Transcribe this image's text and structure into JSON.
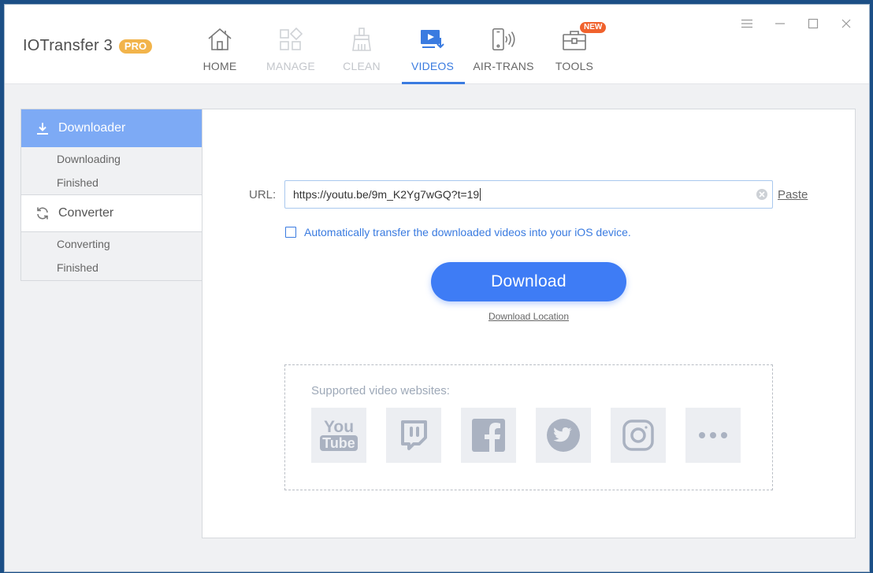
{
  "app": {
    "name": "IOTransfer 3",
    "badge": "PRO"
  },
  "nav": {
    "items": [
      {
        "label": "HOME",
        "icon": "home-icon",
        "state": "normal"
      },
      {
        "label": "MANAGE",
        "icon": "grid-icon",
        "state": "disabled"
      },
      {
        "label": "CLEAN",
        "icon": "broom-icon",
        "state": "disabled"
      },
      {
        "label": "VIDEOS",
        "icon": "video-download-icon",
        "state": "active"
      },
      {
        "label": "AIR-TRANS",
        "icon": "phone-wireless-icon",
        "state": "normal"
      },
      {
        "label": "TOOLS",
        "icon": "toolbox-icon",
        "state": "normal",
        "badge": "NEW"
      }
    ]
  },
  "window_controls": [
    "menu-icon",
    "minimize-icon",
    "maximize-icon",
    "close-icon"
  ],
  "sidebar": {
    "downloader": {
      "label": "Downloader",
      "icon": "download-icon",
      "items": [
        "Downloading",
        "Finished"
      ]
    },
    "converter": {
      "label": "Converter",
      "icon": "refresh-icon",
      "items": [
        "Converting",
        "Finished"
      ]
    }
  },
  "main": {
    "url_label": "URL:",
    "url_value": "https://youtu.be/9m_K2Yg7wGQ?t=19",
    "paste_label": "Paste",
    "auto_transfer_label": "Automatically transfer the downloaded videos into your iOS device.",
    "auto_transfer_checked": false,
    "download_label": "Download",
    "download_location_label": "Download Location",
    "supported_title": "Supported video websites:",
    "sites": [
      {
        "name": "YouTube",
        "logo_top": "You",
        "logo_bottom": "Tube"
      },
      {
        "name": "Twitch"
      },
      {
        "name": "Facebook"
      },
      {
        "name": "Twitter"
      },
      {
        "name": "Instagram"
      },
      {
        "name": "More"
      }
    ]
  },
  "colors": {
    "accent": "#3e7cf5",
    "sidebar_active": "#7daaf5",
    "pro_badge": "#f2b44b",
    "new_badge": "#f0622d",
    "logo_gray": "#aab2c1"
  }
}
